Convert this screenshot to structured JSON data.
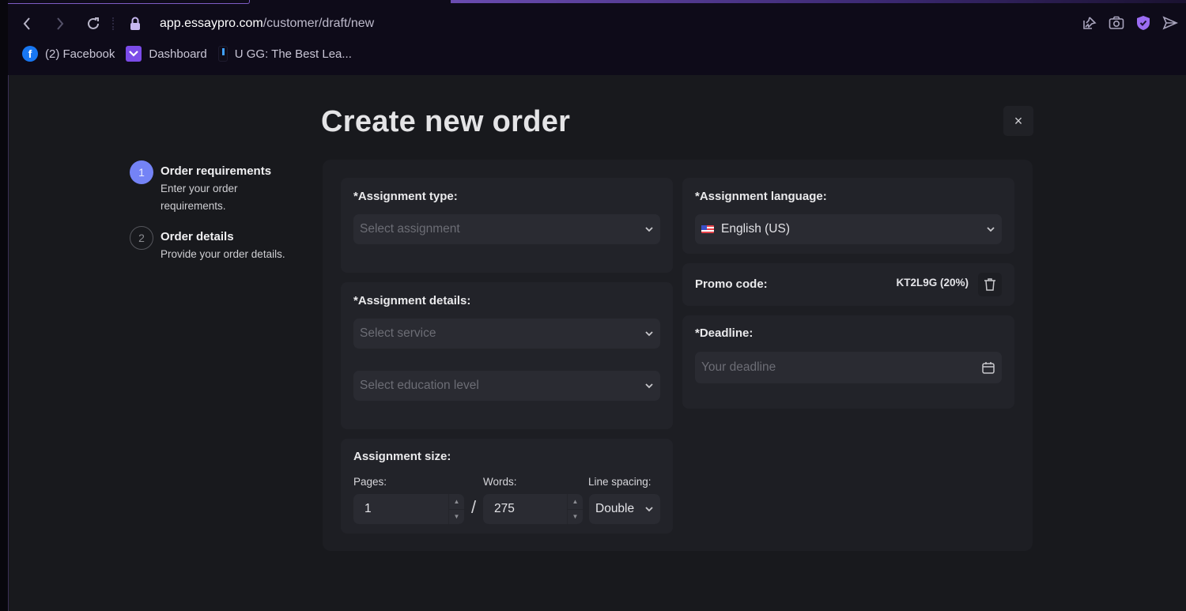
{
  "browser": {
    "url_host": "app.essaypro.com",
    "url_path": "/customer/draft/new",
    "bookmarks": [
      {
        "label": "(2) Facebook",
        "icon": "facebook-icon"
      },
      {
        "label": "Dashboard",
        "icon": "dashboard-icon"
      },
      {
        "label": "U GG: The Best Lea...",
        "icon": "ugg-icon"
      }
    ],
    "toolbar_icons": [
      "pin-edit-icon",
      "camera-icon",
      "shield-check-icon",
      "send-icon"
    ]
  },
  "page": {
    "title": "Create new order",
    "close_icon": "×"
  },
  "steps": [
    {
      "number": "1",
      "title": "Order requirements",
      "desc": "Enter your order requirements.",
      "active": true
    },
    {
      "number": "2",
      "title": "Order details",
      "desc": "Provide your order details.",
      "active": false
    }
  ],
  "form": {
    "assignment_type": {
      "label": "*Assignment type:",
      "placeholder": "Select assignment"
    },
    "assignment_details": {
      "label": "*Assignment details:",
      "service_placeholder": "Select service",
      "education_placeholder": "Select education level"
    },
    "assignment_size": {
      "label": "Assignment size:",
      "pages_label": "Pages:",
      "words_label": "Words:",
      "spacing_label": "Line spacing:",
      "pages_value": "1",
      "separator": "/",
      "words_value": "275",
      "spacing_value": "Double"
    },
    "assignment_language": {
      "label": "*Assignment language:",
      "value": "English (US)"
    },
    "promo": {
      "label": "Promo code:",
      "value": "KT2L9G (20%)"
    },
    "deadline": {
      "label": "*Deadline:",
      "placeholder": "Your deadline"
    }
  },
  "colors": {
    "accent": "#7483f6",
    "background": "#18191d",
    "card": "#222329"
  }
}
